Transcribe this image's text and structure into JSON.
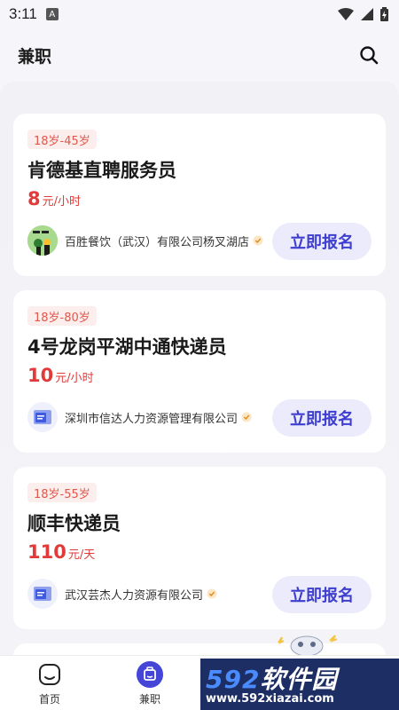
{
  "status_bar": {
    "time": "3:11",
    "notif_letter": "A"
  },
  "header": {
    "title": "兼职"
  },
  "cards": [
    {
      "age": "18岁-45岁",
      "title": "肯德基直聘服务员",
      "salary_num": "8",
      "salary_unit": "元/小时",
      "company": "百胜餐饮（武汉）有限公司杨叉湖店",
      "apply": "立即报名"
    },
    {
      "age": "18岁-80岁",
      "title": "4号龙岗平湖中通快递员",
      "salary_num": "10",
      "salary_unit": "元/小时",
      "company": "深圳市信达人力资源管理有限公司",
      "apply": "立即报名"
    },
    {
      "age": "18岁-55岁",
      "title": "顺丰快递员",
      "salary_num": "110",
      "salary_unit": "元/天",
      "company": "武汉芸杰人力资源有限公司",
      "apply": "立即报名"
    }
  ],
  "tabbar": {
    "items": [
      {
        "label": "首页"
      },
      {
        "label": "兼职"
      }
    ]
  },
  "watermark": {
    "brand": "592软件园",
    "url": "www.592xiazai.com"
  },
  "colors": {
    "accent": "#3d3dd0",
    "price": "#e03a3a",
    "tag_bg": "#fdeeee"
  }
}
